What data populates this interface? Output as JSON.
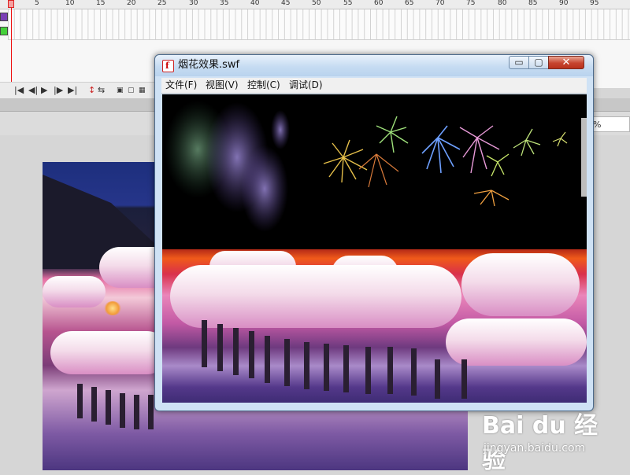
{
  "timeline": {
    "ruler_numbers": [
      "5",
      "10",
      "15",
      "20",
      "25",
      "30",
      "35",
      "40",
      "45",
      "50",
      "55",
      "60",
      "65",
      "70",
      "75",
      "80",
      "85",
      "90",
      "95"
    ],
    "layer_colors": [
      "#7a3fb5",
      "#45d03a"
    ]
  },
  "timeline_controls": {
    "icons": [
      "go-to-start-icon",
      "step-back-icon",
      "play-icon",
      "step-forward-icon",
      "go-to-end-icon",
      "loop-icon",
      "onion-skin-icon",
      "onion-outline-icon",
      "edit-multiple-icon",
      "onion-markers-icon"
    ]
  },
  "stage": {
    "zoom_value": "%"
  },
  "swf_window": {
    "title": "烟花效果.swf",
    "icon": "flash-player-icon",
    "flash_glyph": "f",
    "window_controls": {
      "minimize": "▭",
      "maximize": "▢",
      "close": "✕"
    },
    "menu": [
      {
        "label": "文件(F)"
      },
      {
        "label": "视图(V)"
      },
      {
        "label": "控制(C)"
      },
      {
        "label": "调试(D)"
      }
    ]
  },
  "watermark": {
    "logo": "Bai du 经验",
    "url": "jingyan.baidu.com"
  },
  "colors": {
    "titlebar": "#c6dcf2",
    "close_button": "#c7442f",
    "playhead": "#ee1111"
  }
}
